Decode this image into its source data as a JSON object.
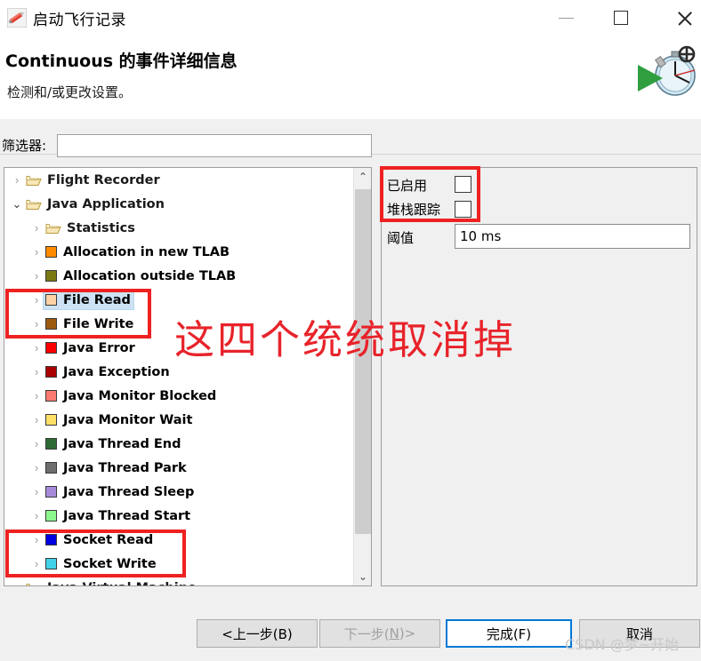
{
  "window": {
    "title": "启动飞行记录",
    "icon": "flight-recorder-icon",
    "minimize_label": "—",
    "maximize_label": "□",
    "close_label": "✕"
  },
  "header": {
    "title": "Continuous 的事件详细信息",
    "subtitle": "检测和/或更改设置。",
    "banner_icon": "stopwatch-play-icon"
  },
  "filter": {
    "label": "筛选器:",
    "value": "",
    "placeholder": ""
  },
  "tree": {
    "scrollbar": {
      "up_label": "⌃",
      "down_label": "⌄"
    },
    "items": [
      {
        "label": "Flight Recorder",
        "type": "folder",
        "indent": 1,
        "expanded": false,
        "arrow": "›",
        "selected": false
      },
      {
        "label": "Java Application",
        "type": "folder",
        "indent": 1,
        "expanded": true,
        "arrow": "⌄",
        "selected": false
      },
      {
        "label": "Statistics",
        "type": "folder",
        "indent": 2,
        "expanded": false,
        "arrow": "›",
        "selected": false
      },
      {
        "label": "Allocation in new TLAB",
        "type": "event",
        "indent": 2,
        "arrow": "›",
        "color": "#ff8c00",
        "selected": false
      },
      {
        "label": "Allocation outside TLAB",
        "type": "event",
        "indent": 2,
        "arrow": "›",
        "color": "#7a7a12",
        "selected": false
      },
      {
        "label": "File Read",
        "type": "event",
        "indent": 2,
        "arrow": "›",
        "color": "#ffd2a6",
        "selected": true
      },
      {
        "label": "File Write",
        "type": "event",
        "indent": 2,
        "arrow": "›",
        "color": "#9c5a10",
        "selected": false
      },
      {
        "label": "Java Error",
        "type": "event",
        "indent": 2,
        "arrow": "›",
        "color": "#fa0000",
        "selected": false
      },
      {
        "label": "Java Exception",
        "type": "event",
        "indent": 2,
        "arrow": "›",
        "color": "#aa0000",
        "selected": false
      },
      {
        "label": "Java Monitor Blocked",
        "type": "event",
        "indent": 2,
        "arrow": "›",
        "color": "#fa7a72",
        "selected": false
      },
      {
        "label": "Java Monitor Wait",
        "type": "event",
        "indent": 2,
        "arrow": "›",
        "color": "#ffe066",
        "selected": false
      },
      {
        "label": "Java Thread End",
        "type": "event",
        "indent": 2,
        "arrow": "›",
        "color": "#2e6b34",
        "selected": false
      },
      {
        "label": "Java Thread Park",
        "type": "event",
        "indent": 2,
        "arrow": "›",
        "color": "#6e6e6e",
        "selected": false
      },
      {
        "label": "Java Thread Sleep",
        "type": "event",
        "indent": 2,
        "arrow": "›",
        "color": "#a78bdb",
        "selected": false
      },
      {
        "label": "Java Thread Start",
        "type": "event",
        "indent": 2,
        "arrow": "›",
        "color": "#8cf78c",
        "selected": false
      },
      {
        "label": "Socket Read",
        "type": "event",
        "indent": 2,
        "arrow": "›",
        "color": "#0000e0",
        "selected": false
      },
      {
        "label": "Socket Write",
        "type": "event",
        "indent": 2,
        "arrow": "›",
        "color": "#3fd2e8",
        "selected": false
      },
      {
        "label": "Java Virtual Machine",
        "type": "folder",
        "indent": 1,
        "expanded": false,
        "arrow": "›",
        "selected": false
      }
    ]
  },
  "settings": {
    "enabled_label": "已启用",
    "enabled_checked": false,
    "stacktrace_label": "堆栈跟踪",
    "stacktrace_checked": false,
    "threshold_label": "阈值",
    "threshold_value": "10 ms"
  },
  "buttons": {
    "back": "<上一步(B)",
    "next_prefix": "下一步(",
    "next_key": "N",
    "next_suffix": ")>",
    "finish": "完成(F)",
    "cancel": "取消"
  },
  "annotations": {
    "note": "这四个统统取消掉",
    "note_color": "#e8232a",
    "watermark": "CSDN @梦~开始"
  }
}
